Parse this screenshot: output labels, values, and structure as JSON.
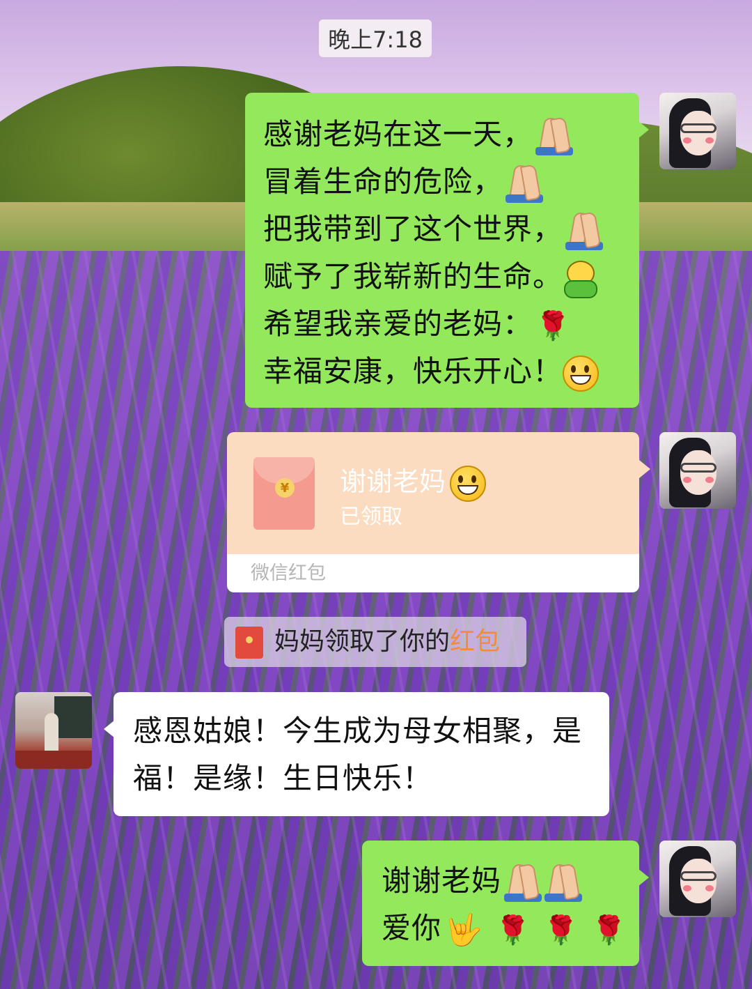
{
  "timestamp": "晚上7:18",
  "messages": {
    "m1": {
      "lines": [
        {
          "text": "感谢老妈在这一天，",
          "emoji": "folded-hands"
        },
        {
          "text": "冒着生命的危险，",
          "emoji": "folded-hands"
        },
        {
          "text": "把我带到了这个世界，",
          "emoji": "folded-hands"
        },
        {
          "text": "赋予了我崭新的生命。",
          "emoji": "frog-mascot"
        },
        {
          "text": "希望我亲爱的老妈：",
          "emoji": "rose"
        },
        {
          "text": "幸福安康，快乐开心！",
          "emoji": "grinning-face"
        }
      ]
    },
    "red_packet": {
      "title": "谢谢老妈",
      "title_emoji": "smiling-face",
      "status": "已领取",
      "footer": "微信红包"
    },
    "notice": {
      "prefix": "妈妈领取了你的",
      "link": "红包"
    },
    "m2": {
      "line1": "感恩姑娘！今生成为母女相聚，是",
      "line2": "福！是缘！生日快乐！"
    },
    "m3": {
      "line1": "谢谢老妈",
      "line2": "爱你",
      "line1_emoji": "folded-hands x2",
      "line2_emoji": "love-you-gesture, rose x3"
    }
  },
  "colors": {
    "bubble_self": "#93e85b",
    "bubble_other": "#ffffff",
    "red_packet_bg": "#fbdcc0",
    "link": "#f28b3c"
  }
}
